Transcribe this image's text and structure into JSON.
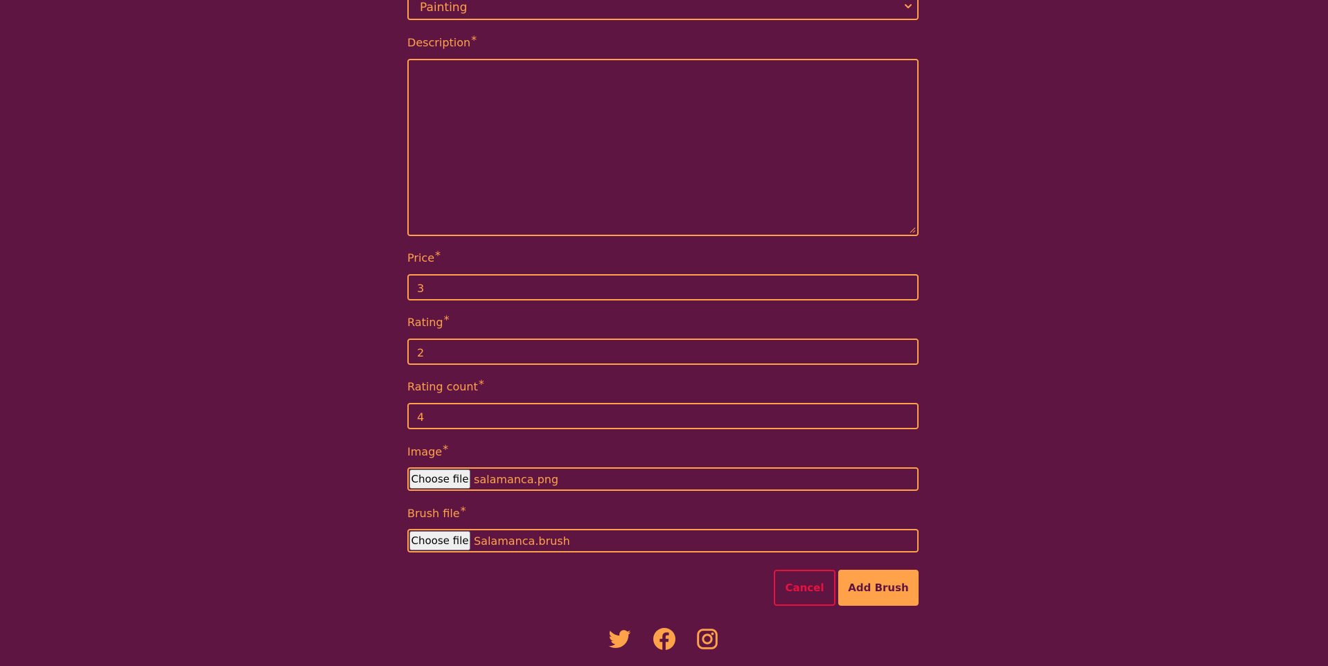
{
  "form": {
    "category": {
      "selected": "Painting"
    },
    "description": {
      "label": "Description",
      "required_mark": "*",
      "value": ""
    },
    "price": {
      "label": "Price",
      "required_mark": "*",
      "value": "3"
    },
    "rating": {
      "label": "Rating",
      "required_mark": "*",
      "value": "2"
    },
    "rating_count": {
      "label": "Rating count",
      "required_mark": "*",
      "value": "4"
    },
    "image": {
      "label": "Image",
      "required_mark": "*",
      "button_label": "Choose file",
      "file_name": "salamanca.png"
    },
    "brush_file": {
      "label": "Brush file",
      "required_mark": "*",
      "button_label": "Choose file",
      "file_name": "Salamanca.brush"
    },
    "actions": {
      "cancel_label": "Cancel",
      "submit_label": "Add Brush"
    }
  },
  "footer": {
    "social_icons": [
      "twitter-icon",
      "facebook-icon",
      "instagram-icon"
    ]
  },
  "colors": {
    "background": "#5e1541",
    "accent": "#ffa24a",
    "danger": "#e8123f"
  }
}
